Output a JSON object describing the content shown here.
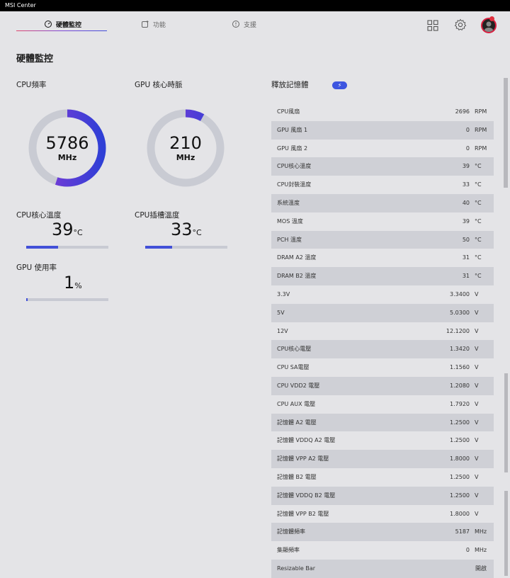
{
  "app": {
    "title": "MSI Center"
  },
  "tabs": [
    {
      "label": "硬體監控",
      "icon": "gauge-icon",
      "active": true
    },
    {
      "label": "功能",
      "icon": "feature-icon"
    },
    {
      "label": "支援",
      "icon": "support-icon"
    }
  ],
  "topbar": {
    "grid_icon": "grid-icon",
    "settings_icon": "gear-icon",
    "avatar": "user-avatar"
  },
  "page": {
    "title": "硬體監控"
  },
  "cpu_freq": {
    "label": "CPU頻率",
    "value": "5786",
    "unit": "MHz",
    "fraction": 0.55
  },
  "gpu_clock": {
    "label": "GPU 核心時脈",
    "value": "210",
    "unit": "MHz",
    "fraction": 0.08
  },
  "cpu_core_temp": {
    "label": "CPU核心溫度",
    "value": "39",
    "unit": "°C",
    "fraction": 0.39
  },
  "cpu_socket_temp": {
    "label": "CPU插槽溫度",
    "value": "33",
    "unit": "°C",
    "fraction": 0.33
  },
  "gpu_usage": {
    "label": "GPU 使用率",
    "value": "1",
    "unit": "%",
    "fraction": 0.01
  },
  "memory_release": {
    "label": "釋放記憶體",
    "button_icon": "bolt-icon"
  },
  "accent": "#4250d8",
  "sensors": [
    {
      "name": "CPU風扇",
      "value": "2696",
      "unit": "RPM"
    },
    {
      "name": "GPU 風扇 1",
      "value": "0",
      "unit": "RPM"
    },
    {
      "name": "GPU 風扇 2",
      "value": "0",
      "unit": "RPM"
    },
    {
      "name": "CPU核心溫度",
      "value": "39",
      "unit": "°C"
    },
    {
      "name": "CPU封裝溫度",
      "value": "33",
      "unit": "°C"
    },
    {
      "name": "系統溫度",
      "value": "40",
      "unit": "°C"
    },
    {
      "name": "MOS 溫度",
      "value": "39",
      "unit": "°C"
    },
    {
      "name": "PCH 溫度",
      "value": "50",
      "unit": "°C"
    },
    {
      "name": "DRAM A2 溫度",
      "value": "31",
      "unit": "°C"
    },
    {
      "name": "DRAM B2 溫度",
      "value": "31",
      "unit": "°C"
    },
    {
      "name": "3.3V",
      "value": "3.3400",
      "unit": "V"
    },
    {
      "name": "5V",
      "value": "5.0300",
      "unit": "V"
    },
    {
      "name": "12V",
      "value": "12.1200",
      "unit": "V"
    },
    {
      "name": "CPU核心電壓",
      "value": "1.3420",
      "unit": "V"
    },
    {
      "name": "CPU SA電壓",
      "value": "1.1560",
      "unit": "V"
    },
    {
      "name": "CPU VDD2 電壓",
      "value": "1.2080",
      "unit": "V"
    },
    {
      "name": "CPU AUX 電壓",
      "value": "1.7920",
      "unit": "V"
    },
    {
      "name": "記憶體 A2 電壓",
      "value": "1.2500",
      "unit": "V"
    },
    {
      "name": "記憶體 VDDQ A2 電壓",
      "value": "1.2500",
      "unit": "V"
    },
    {
      "name": "記憶體 VPP A2 電壓",
      "value": "1.8000",
      "unit": "V"
    },
    {
      "name": "記憶體 B2 電壓",
      "value": "1.2500",
      "unit": "V"
    },
    {
      "name": "記憶體 VDDQ B2 電壓",
      "value": "1.2500",
      "unit": "V"
    },
    {
      "name": "記憶體 VPP B2 電壓",
      "value": "1.8000",
      "unit": "V"
    },
    {
      "name": "記憶體頻率",
      "value": "5187",
      "unit": "MHz"
    },
    {
      "name": "集顯頻率",
      "value": "0",
      "unit": "MHz"
    },
    {
      "name": "Resizable Bar",
      "value": "",
      "unit": "",
      "status": "開啟"
    }
  ]
}
